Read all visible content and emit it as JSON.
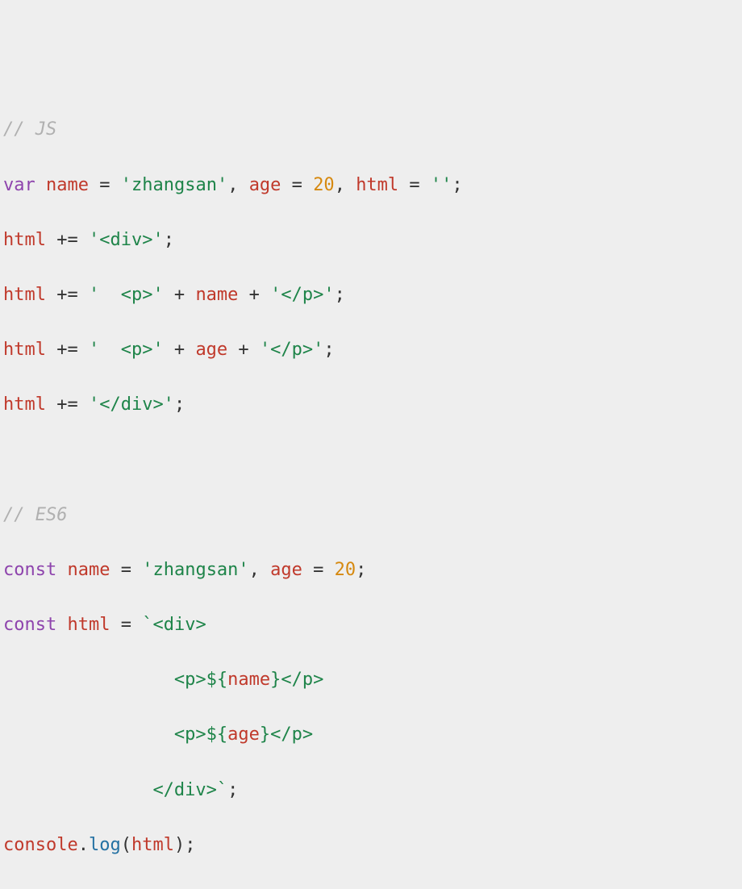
{
  "code": {
    "l1": {
      "cmt": "// JS"
    },
    "l2": {
      "kw": "var",
      "id1": "name",
      "eq1": " = ",
      "s1": "'zhangsan'",
      "c1": ", ",
      "id2": "age",
      "eq2": " = ",
      "n1": "20",
      "c2": ", ",
      "id3": "html",
      "eq3": " = ",
      "s2": "''",
      "semi": ";"
    },
    "l3": {
      "id": "html",
      "op": " += ",
      "s": "'<div>'",
      "semi": ";"
    },
    "l4": {
      "id": "html",
      "op": " += ",
      "s1": "'  <p>'",
      "p1": " + ",
      "id2": "name",
      "p2": " + ",
      "s2": "'</p>'",
      "semi": ";"
    },
    "l5": {
      "id": "html",
      "op": " += ",
      "s1": "'  <p>'",
      "p1": " + ",
      "id2": "age",
      "p2": " + ",
      "s2": "'</p>'",
      "semi": ";"
    },
    "l6": {
      "id": "html",
      "op": " += ",
      "s": "'</div>'",
      "semi": ";"
    },
    "l7": {
      "blank": " "
    },
    "l8": {
      "cmt": "// ES6"
    },
    "l9": {
      "kw": "const",
      "id1": "name",
      "eq1": " = ",
      "s1": "'zhangsan'",
      "c1": ", ",
      "id2": "age",
      "eq2": " = ",
      "n1": "20",
      "semi": ";"
    },
    "l10": {
      "kw": "const",
      "id": "html",
      "eq": " = ",
      "bt": "`",
      "s": "<div>"
    },
    "l11": {
      "pad": "                ",
      "s1": "<p>",
      "d1": "${",
      "id": "name",
      "d2": "}",
      "s2": "</p>"
    },
    "l12": {
      "pad": "                ",
      "s1": "<p>",
      "d1": "${",
      "id": "age",
      "d2": "}",
      "s2": "</p>"
    },
    "l13": {
      "pad": "              ",
      "s": "</div>",
      "bt": "`",
      "semi": ";"
    },
    "l14": {
      "obj": "console",
      "dot": ".",
      "fn": "log",
      "op1": "(",
      "id": "html",
      "op2": ")",
      "semi": ";"
    }
  }
}
